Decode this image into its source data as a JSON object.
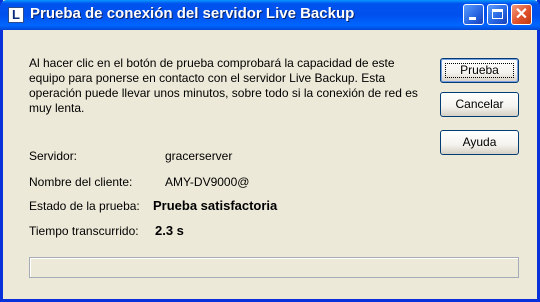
{
  "window": {
    "title": "Prueba de conexión del servidor Live Backup",
    "app_icon_glyph": "L"
  },
  "titlebar_controls": {
    "close_glyph": "✕"
  },
  "description": "Al hacer clic en el botón de prueba comprobará la capacidad de este equipo para ponerse en contacto con el servidor Live Backup.  Esta operación puede llevar unos minutos, sobre todo si la conexión de red es muy lenta.",
  "fields": {
    "server_label": "Servidor:",
    "server_value": "gracerserver",
    "client_label": "Nombre del cliente:",
    "client_value": "AMY-DV9000@",
    "status_label": "Estado de la prueba:",
    "status_value": "Prueba satisfactoria",
    "elapsed_label": "Tiempo transcurrido:",
    "elapsed_value": "2.3 s"
  },
  "buttons": {
    "test": "Prueba",
    "cancel": "Cancelar",
    "help": "Ayuda"
  },
  "colors": {
    "titlebar": "#0053ee",
    "window_bg": "#ece9d8",
    "close_button": "#e0522c"
  }
}
